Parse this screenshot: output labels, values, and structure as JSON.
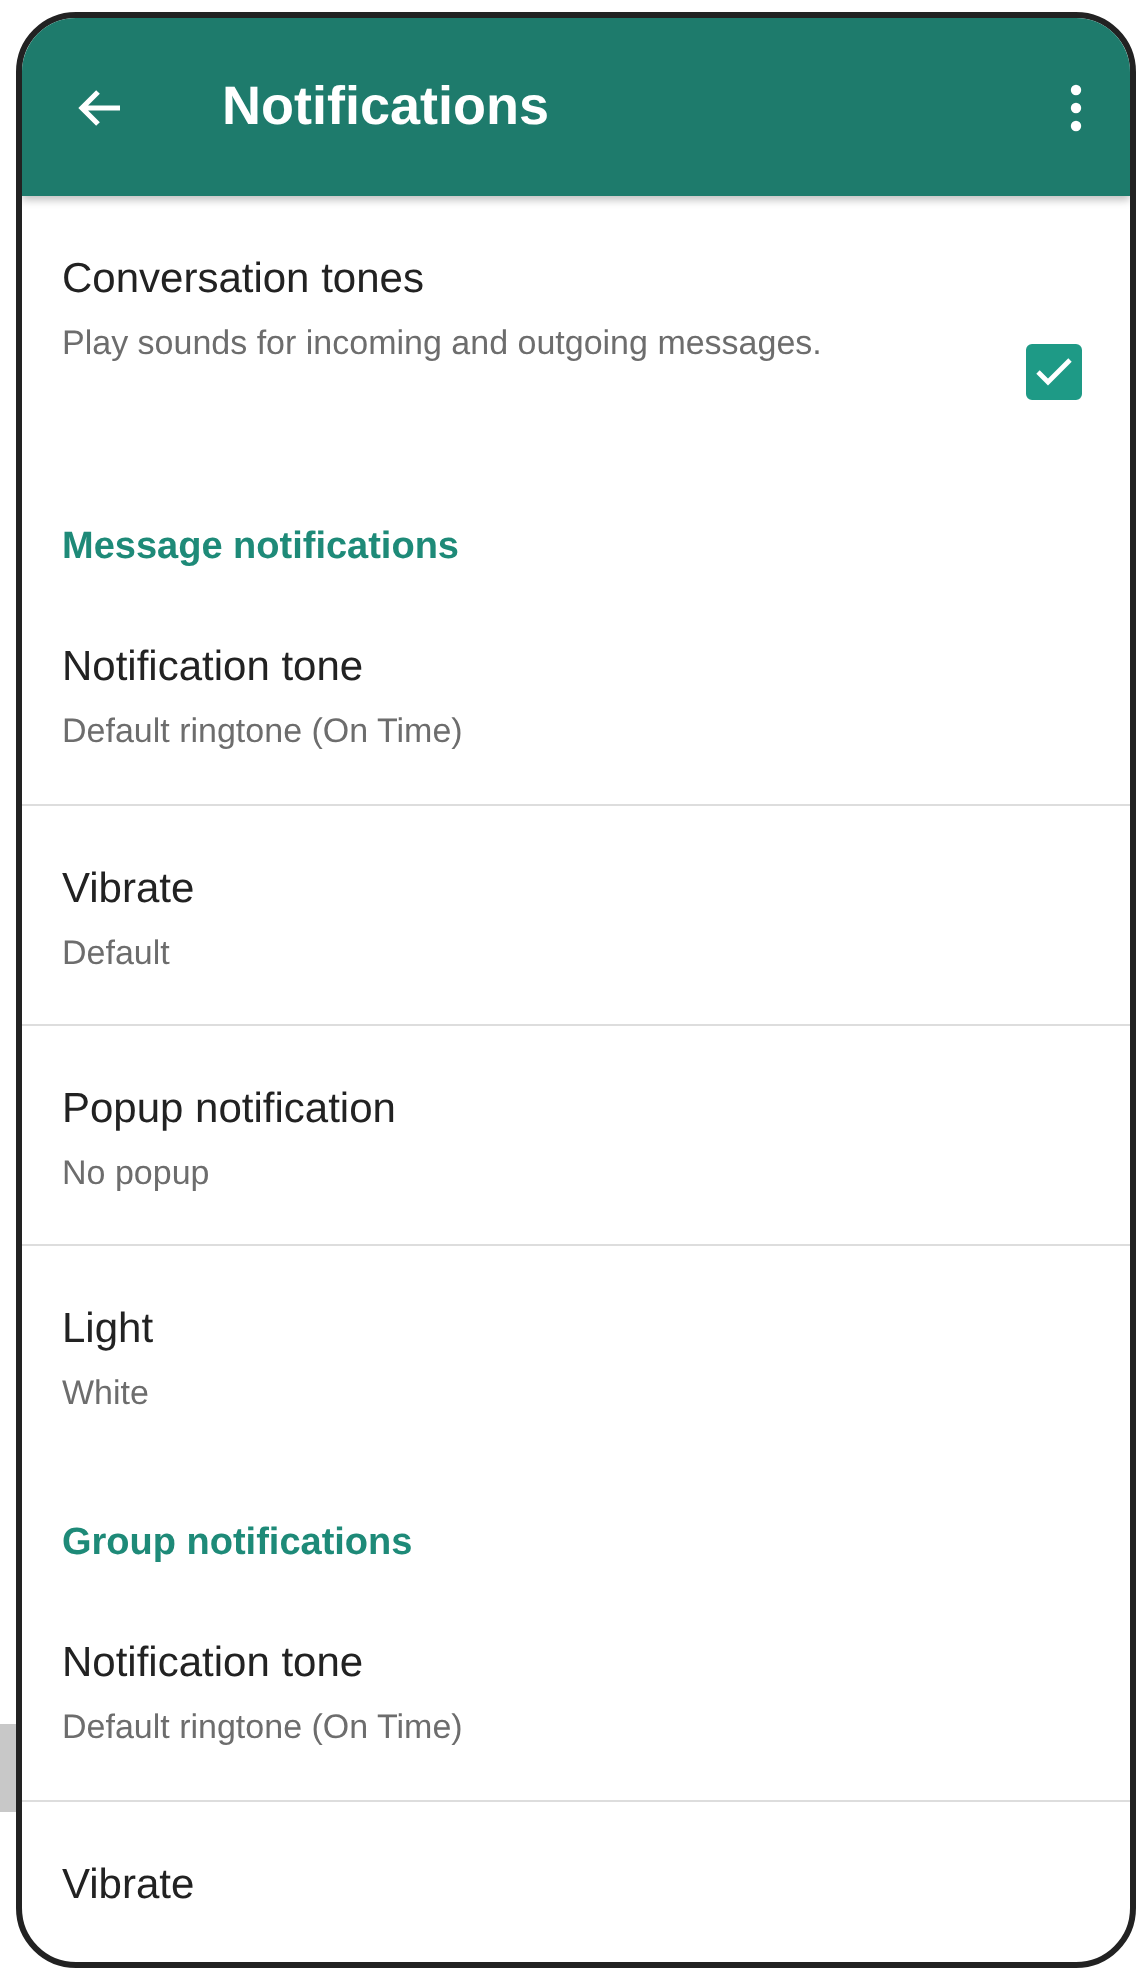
{
  "app_bar": {
    "title": "Notifications"
  },
  "items": [
    {
      "kind": "checkbox",
      "title": "Conversation tones",
      "subtitle": "Play sounds for incoming and outgoing messages.",
      "checked": true
    },
    {
      "kind": "section",
      "title": "Message notifications"
    },
    {
      "kind": "setting",
      "title": "Notification tone",
      "subtitle": "Default ringtone (On Time)"
    },
    {
      "kind": "setting",
      "title": "Vibrate",
      "subtitle": "Default"
    },
    {
      "kind": "setting",
      "title": "Popup notification",
      "subtitle": "No popup"
    },
    {
      "kind": "setting",
      "title": "Light",
      "subtitle": "White"
    },
    {
      "kind": "section",
      "title": "Group notifications"
    },
    {
      "kind": "setting",
      "title": "Notification tone",
      "subtitle": "Default ringtone (On Time)"
    },
    {
      "kind": "setting",
      "title": "Vibrate"
    }
  ]
}
